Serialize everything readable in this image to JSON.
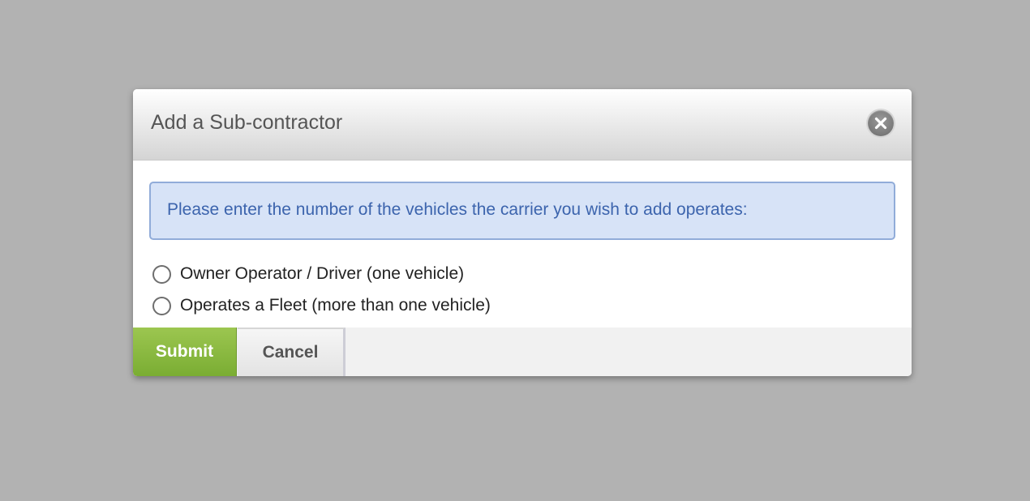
{
  "dialog": {
    "title": "Add a Sub-contractor",
    "close_icon": "close-icon",
    "info_message": "Please enter the number of the vehicles the carrier you wish to add operates:",
    "options": [
      {
        "label": "Owner Operator / Driver (one vehicle)",
        "selected": false
      },
      {
        "label": "Operates a Fleet (more than one vehicle)",
        "selected": false
      }
    ],
    "submit_label": "Submit",
    "cancel_label": "Cancel"
  },
  "colors": {
    "overlay": "#b2b2b2",
    "info_background": "#d7e3f7",
    "info_border": "#91acd9",
    "info_text": "#3c64ad",
    "submit_green": "#7aad33"
  }
}
